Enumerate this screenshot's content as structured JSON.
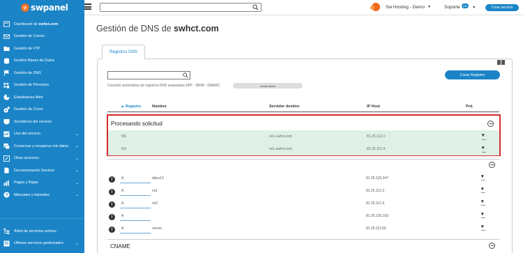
{
  "brand": {
    "name": "swpanel"
  },
  "sidebar": {
    "items": [
      {
        "label_prefix": "Dashboard de ",
        "label_bold": "swhct.com",
        "icon": "dashboard-icon"
      },
      {
        "label": "Gestión de Correo",
        "icon": "mail-icon"
      },
      {
        "label": "Gestión de FTP",
        "icon": "folder-icon"
      },
      {
        "label": "Gestión Bases de Datos",
        "icon": "database-icon"
      },
      {
        "label": "Gestión de DNS",
        "icon": "flag-icon"
      },
      {
        "label": "Gestión de Permisos",
        "icon": "permissions-icon"
      },
      {
        "label": "Estadísticas Web",
        "icon": "pie-chart-icon"
      },
      {
        "label": "Gestión de Crons",
        "icon": "gear-icon"
      },
      {
        "label": "Servidores del servicio",
        "icon": "server-icon"
      },
      {
        "label": "Uso del servicio",
        "icon": "chart-icon",
        "expandable": true
      },
      {
        "label": "Conservar y recuperar mis datos",
        "icon": "backup-icon",
        "expandable": true
      },
      {
        "label": "Otras acciones",
        "icon": "edit-icon",
        "expandable": true
      },
      {
        "label": "Documentación Servicio",
        "icon": "document-icon",
        "expandable": true
      },
      {
        "label": "Pagos y Bajas",
        "icon": "payments-icon",
        "expandable": true
      },
      {
        "label": "Manuales y tutoriales",
        "icon": "help-icon",
        "expandable": true
      }
    ],
    "bottom_items": [
      {
        "label": "Árbol de servicios activos",
        "icon": "tree-icon"
      },
      {
        "label": "Últimos servicios gestionados",
        "icon": "history-icon",
        "expandable": true
      }
    ]
  },
  "topbar": {
    "search_value": "",
    "company": "Sw Hosting - Demo",
    "support_label": "Soporte",
    "support_badge": "ON",
    "create_service": "Crear servicio"
  },
  "main": {
    "title_prefix": "Gestión de DNS de ",
    "title_domain": "swhct.com",
    "tab_label": "Registros DNS",
    "search_value": "",
    "auto_text": "Creación automática de registros DNS avanzados SPF - DKIM - DMARC",
    "create_now": "Crear ahora",
    "create_record": "Crear Registro",
    "headers": {
      "registro": "Registro",
      "nombre": "Nombre",
      "servidor": "Servidor destino",
      "ip": "IP Host",
      "prd": "Prd."
    },
    "processing": {
      "title": "Procesando solicitud",
      "rows": [
        {
          "type": "NS",
          "server": "ns1.swhct.com",
          "ip": "81.25.112.3",
          "actions": "..."
        },
        {
          "type": "NS",
          "server": "ns1.swhct.com",
          "ip": "81.25.112.4",
          "actions": "..."
        }
      ]
    },
    "records": [
      {
        "type": "A",
        "name": "ddoo13",
        "ip": "81.25.125.247",
        "actions": "..."
      },
      {
        "type": "A",
        "name": "ns1",
        "ip": "81.25.112.3",
        "actions": "..."
      },
      {
        "type": "A",
        "name": "ns2",
        "ip": "81.25.112.4",
        "actions": "..."
      },
      {
        "type": "A",
        "name": "",
        "ip": "81.25.126.193",
        "actions": "..."
      },
      {
        "type": "A",
        "name": "correo",
        "ip": "81.25.112.60",
        "actions": "..."
      }
    ],
    "cname_section": "CNAME"
  },
  "colors": {
    "primary": "#1a84c7",
    "accent": "#f26a1b",
    "highlight_border": "#d42a2a",
    "pending_row": "#dff1e6"
  }
}
